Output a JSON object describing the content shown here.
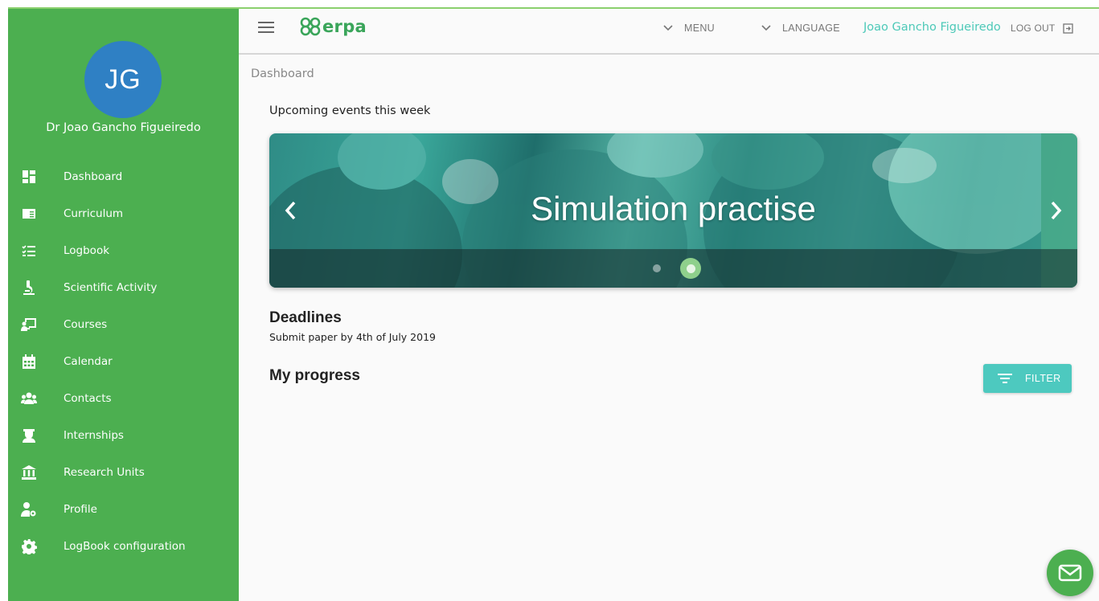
{
  "colors": {
    "sidebar": "#4caf50",
    "avatar": "#2f80c4",
    "accent": "#4dc9bf",
    "logo": "#3aa55a"
  },
  "sidebar": {
    "avatar_initials": "JG",
    "user_name": "Dr Joao Gancho Figueiredo",
    "items": [
      {
        "label": "Dashboard",
        "icon": "dashboard-icon"
      },
      {
        "label": "Curriculum",
        "icon": "curriculum-icon"
      },
      {
        "label": "Logbook",
        "icon": "checklist-icon"
      },
      {
        "label": "Scientific Activity",
        "icon": "microscope-icon"
      },
      {
        "label": "Courses",
        "icon": "presentation-icon"
      },
      {
        "label": "Calendar",
        "icon": "calendar-icon"
      },
      {
        "label": "Contacts",
        "icon": "group-icon"
      },
      {
        "label": "Internships",
        "icon": "graduate-icon"
      },
      {
        "label": "Research Units",
        "icon": "institution-icon"
      },
      {
        "label": "Profile",
        "icon": "user-settings-icon"
      },
      {
        "label": "LogBook configuration",
        "icon": "gear-icon"
      }
    ]
  },
  "topbar": {
    "logo_text": "erpa",
    "menu_label": "MENU",
    "language_label": "LANGUAGE",
    "user_name": "Joao Gancho Figueiredo",
    "logout_label": "LOG OUT"
  },
  "main": {
    "breadcrumb": "Dashboard",
    "upcoming_title": "Upcoming events this week",
    "carousel": {
      "slide_title": "Simulation practise",
      "active_slide": 2,
      "slide_count": 2
    },
    "deadlines_title": "Deadlines",
    "deadline_item": "Submit paper by 4th of July 2019",
    "progress_title": "My progress",
    "filter_label": "FILTER"
  }
}
